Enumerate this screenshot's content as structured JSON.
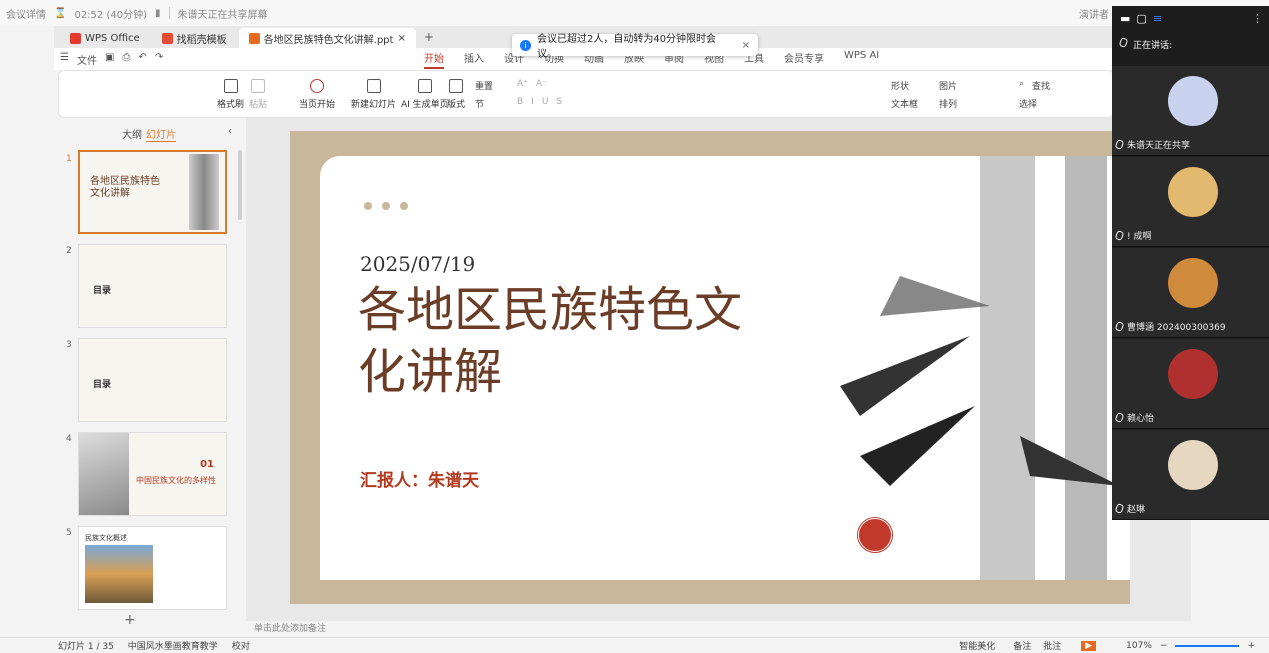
{
  "meeting_bar": {
    "details": "会议详情",
    "timer": "02:52 (40分钟)",
    "sharing": "朱谱天正在共享屏幕",
    "presenter_view": "演讲者"
  },
  "tabs": [
    {
      "label": "WPS Office"
    },
    {
      "label": "找稻壳模板"
    },
    {
      "label": "各地区民族特色文化讲解.ppt"
    }
  ],
  "menu": {
    "file": "文件",
    "tabs": [
      "开始",
      "插入",
      "设计",
      "切换",
      "动画",
      "放映",
      "审阅",
      "视图",
      "工具",
      "会员专享",
      "WPS AI"
    ],
    "active": "开始"
  },
  "toast": {
    "text": "会议已超过2人，自动转为40分钟限时会议。"
  },
  "ribbon": {
    "format_painter": "格式刷",
    "paste": "粘贴",
    "play_from_current": "当页开始",
    "new_slide": "新建幻灯片",
    "ai_slide": "AI 生成单页",
    "layout": "版式",
    "section": "节",
    "reset": "重置",
    "shapes": "形状",
    "picture": "图片",
    "textbox": "文本框",
    "arrange": "排列",
    "find": "查找",
    "select": "选择"
  },
  "left_panel": {
    "outline": "大纲",
    "slides": "幻灯片",
    "thumbs": [
      {
        "num": "1",
        "title": "各地区民族特色文化讲解"
      },
      {
        "num": "2",
        "title": "目录"
      },
      {
        "num": "3",
        "title": "目录"
      },
      {
        "num": "4",
        "title": "中国民族文化的多样性",
        "sub": "01"
      },
      {
        "num": "5",
        "title": "民族文化概述"
      }
    ]
  },
  "slide": {
    "date": "2025/07/19",
    "title_line1": "各地区民族特色文",
    "title_line2": "化讲解",
    "reporter": "汇报人：朱谱天"
  },
  "notes": {
    "placeholder": "单击此处添加备注"
  },
  "status": {
    "slide_count": "幻灯片 1 / 35",
    "theme": "中国风水墨画教育教学",
    "proof": "校对",
    "beautify": "智能美化",
    "notes": "备注",
    "comment": "批注",
    "zoom": "107%"
  },
  "participants": {
    "speaking": "正在讲话:",
    "list": [
      {
        "name": "朱谱天正在共享",
        "color": "#c9d3f0"
      },
      {
        "name": "! 成啊",
        "color": "#e3b86f"
      },
      {
        "name": "曹博涵 202400300369",
        "color": "#d08a3c"
      },
      {
        "name": "赖心怡",
        "color": "#b03030"
      },
      {
        "name": "赵琳",
        "color": "#e8d7c0"
      }
    ]
  }
}
